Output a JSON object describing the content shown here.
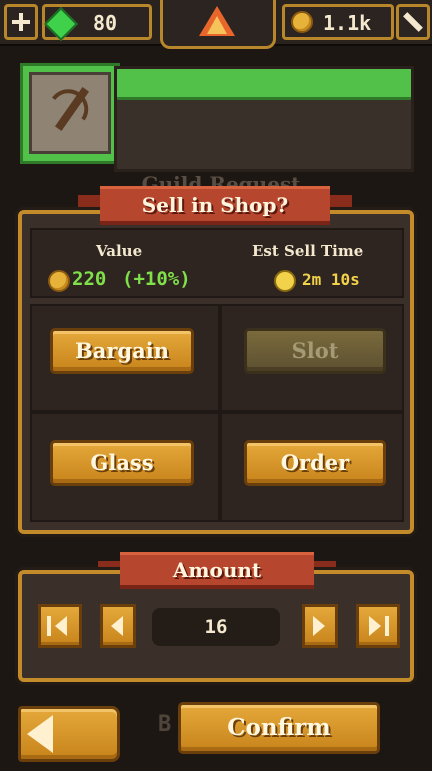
{
  "top_bar": {
    "gems": "80",
    "coins": "1.1k"
  },
  "item": {
    "icon": "crossbow-icon"
  },
  "background_text": "Guild Request",
  "sell_dialog": {
    "title": "Sell in Shop?",
    "value_label": "Value",
    "value_amount": "220",
    "value_bonus": "(+10%)",
    "sell_time_label": "Est Sell Time",
    "sell_time_value": "2m 10s",
    "buttons": {
      "bargain": "Bargain",
      "slot": "Slot",
      "glass": "Glass",
      "order": "Order"
    }
  },
  "amount_dialog": {
    "title": "Amount",
    "value": "16"
  },
  "footer": {
    "confirm": "Confirm",
    "partial_button_text": "B"
  },
  "colors": {
    "gold": "#c48b2a",
    "gem_green": "#3fd14a",
    "value_green": "#7fe04a",
    "ribbon_red": "#b7462e",
    "time_yellow": "#f3d24b"
  }
}
